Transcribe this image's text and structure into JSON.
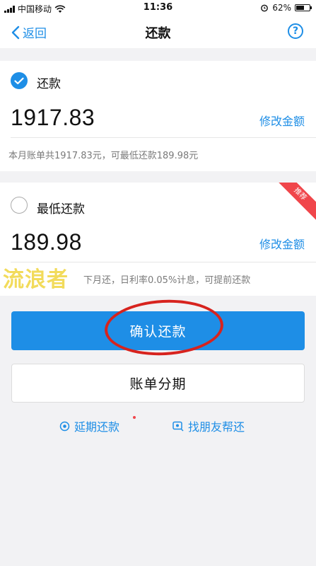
{
  "status_bar": {
    "carrier": "中国移动",
    "time": "11:36",
    "battery": "62%",
    "battery_level": 0.62
  },
  "nav": {
    "back_label": "返回",
    "title": "还款",
    "help_symbol": "?"
  },
  "option_full": {
    "label": "还款",
    "checked": true,
    "amount": "1917.83",
    "modify_label": "修改金额",
    "note": "本月账单共1917.83元，可最低还款189.98元"
  },
  "option_min": {
    "label": "最低还款",
    "checked": false,
    "amount": "189.98",
    "modify_label": "修改金额",
    "ribbon": "推荐",
    "note": "下月还，日利率0.05%计息，可提前还款"
  },
  "watermark": "流浪者",
  "buttons": {
    "confirm": "确认还款",
    "installment": "账单分期"
  },
  "links": {
    "delay": "延期还款",
    "friend": "找朋友帮还"
  },
  "colors": {
    "accent": "#1e8ee6",
    "ribbon": "#f0464b",
    "annotation_circle": "#d7231e"
  }
}
